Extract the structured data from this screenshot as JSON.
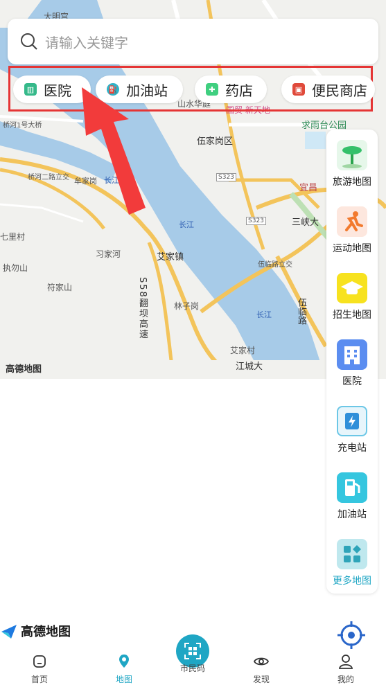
{
  "search": {
    "placeholder": "请输入关键字",
    "icon": "search-icon"
  },
  "quick": [
    {
      "label": "医院",
      "icon": "hospital-icon",
      "color": "#35b98a"
    },
    {
      "label": "加油站",
      "icon": "gas-station-icon",
      "color": "#2fb3c8"
    },
    {
      "label": "药店",
      "icon": "pharmacy-icon",
      "color": "#3fcf7f"
    },
    {
      "label": "便民商店",
      "icon": "store-icon",
      "color": "#e04a3b"
    }
  ],
  "map": {
    "labels": {
      "damingsi": "大明宫",
      "shanshui": "山水华庭",
      "guomao": "国贸·新天地",
      "qiuyutai": "求雨台公园",
      "wujiagang": "伍家岗区",
      "qiaohe1": "桥河1号大桥",
      "qiaohe2": "桥河二路立交",
      "moujiagang": "牟家岗",
      "changjiang1": "长江",
      "changjiang2": "长江",
      "changjiang3": "长江",
      "s323a": "S323",
      "s323b": "S323",
      "yichang": "宜昌",
      "sanxia": "三峡大",
      "qilicun": "七里村",
      "xijiahe": "习家河",
      "aijiazhen": "艾家镇",
      "wulinlu": "伍临路立交",
      "zhiwushan": "执勿山",
      "fujiashan": "符家山",
      "s58": "S58翻坝高速",
      "linzigang": "林子岗",
      "wulinlu2": "伍临路",
      "aijiacun": "艾家村",
      "jiangcheng": "江城大",
      "logo": "高德地图"
    }
  },
  "sidebar": [
    {
      "label": "旅游地图",
      "icon": "palm-tree-icon",
      "color": "#e6f7ea"
    },
    {
      "label": "运动地图",
      "icon": "runner-icon",
      "color": "#fde7de"
    },
    {
      "label": "招生地图",
      "icon": "graduation-cap-icon",
      "color": "#f7e21f"
    },
    {
      "label": "医院",
      "icon": "hospital-building-icon",
      "color": "#5b8df0"
    },
    {
      "label": "充电站",
      "icon": "charging-station-icon",
      "color": "#e7f5fb"
    },
    {
      "label": "加油站",
      "icon": "fuel-pump-icon",
      "color": "#35c6df"
    },
    {
      "label": "更多地图",
      "icon": "more-apps-icon",
      "color": "#bfe8ee"
    }
  ],
  "footer": {
    "logo_text": "高德地图"
  },
  "tabs": [
    {
      "label": "首页",
      "icon": "home-icon"
    },
    {
      "label": "地图",
      "icon": "map-pin-icon"
    },
    {
      "label": "市民码",
      "icon": "qr-code-icon"
    },
    {
      "label": "发现",
      "icon": "eye-icon"
    },
    {
      "label": "我的",
      "icon": "user-icon"
    }
  ],
  "colors": {
    "accent": "#1fa6c4",
    "highlight": "#e53535",
    "river": "#a7cbe8"
  }
}
